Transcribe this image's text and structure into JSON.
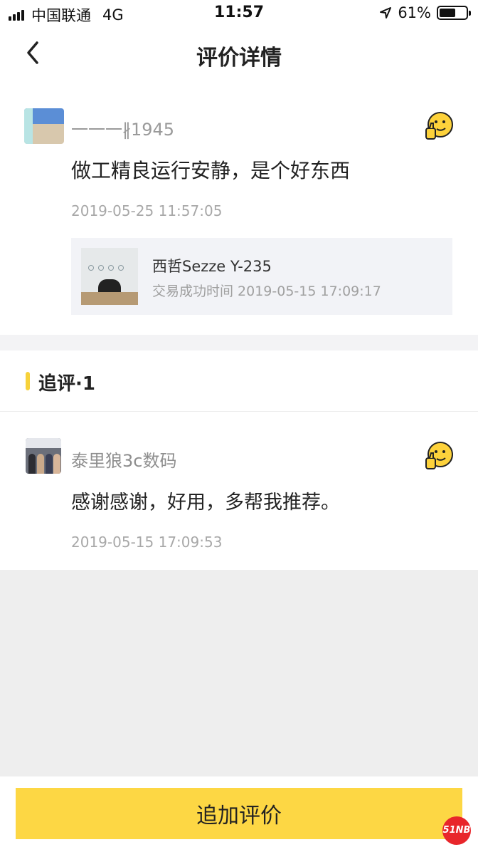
{
  "status_bar": {
    "carrier": "中国联通",
    "network": "4G",
    "time": "11:57",
    "battery_percent": "61%",
    "battery_level": 0.61
  },
  "nav": {
    "title": "评价详情",
    "back_icon": "chevron-left-icon"
  },
  "review": {
    "username": "一一一∦1945",
    "text": "做工精良运行安静，是个好东西",
    "time": "2019-05-25 11:57:05",
    "like_icon": "thumbs-up-emoji-icon",
    "product": {
      "name": "西哲Sezze Y-235",
      "deal_time": "交易成功时间 2019-05-15 17:09:17"
    }
  },
  "followup": {
    "title": "追评·1"
  },
  "reply": {
    "username": "泰里狼3c数码",
    "text": "感谢感谢，好用，多帮我推荐。",
    "time": "2019-05-15 17:09:53",
    "like_icon": "thumbs-up-emoji-icon"
  },
  "bottom": {
    "add_review_label": "追加评价"
  },
  "watermark": {
    "text": "51NB"
  },
  "colors": {
    "accent": "#fdd744",
    "section_bar": "#f7d23a",
    "page_bg_gray": "#eeeeee"
  }
}
